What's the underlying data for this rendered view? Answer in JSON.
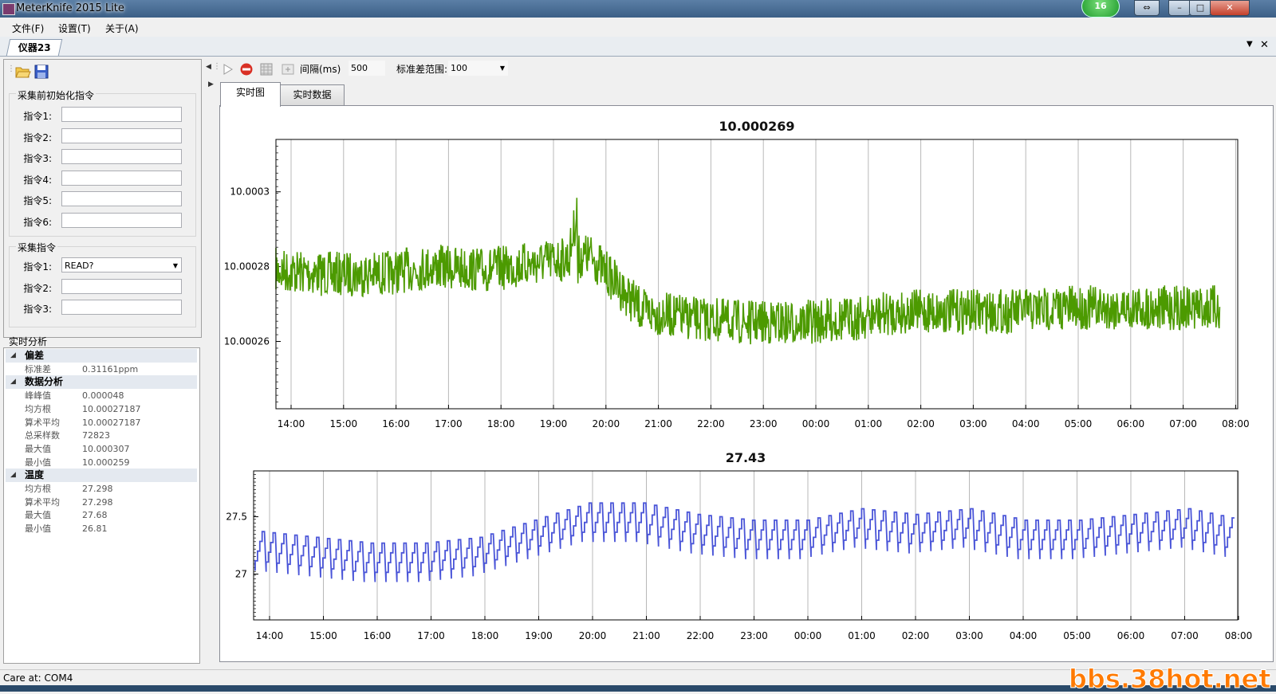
{
  "window": {
    "title": "MeterKnife 2015 Lite",
    "badge": "16"
  },
  "menu": {
    "file": "文件(F)",
    "settings": "设置(T)",
    "about": "关于(A)"
  },
  "doc_tab": "仪器23",
  "init_group": {
    "title": "采集前初始化指令",
    "fields": [
      {
        "label": "指令1:",
        "value": ""
      },
      {
        "label": "指令2:",
        "value": ""
      },
      {
        "label": "指令3:",
        "value": ""
      },
      {
        "label": "指令4:",
        "value": ""
      },
      {
        "label": "指令5:",
        "value": ""
      },
      {
        "label": "指令6:",
        "value": ""
      }
    ]
  },
  "acq_group": {
    "title": "采集指令",
    "fields": [
      {
        "label": "指令1:",
        "value": "READ?"
      },
      {
        "label": "指令2:",
        "value": ""
      },
      {
        "label": "指令3:",
        "value": ""
      }
    ]
  },
  "analysis": {
    "title": "实时分析",
    "rows": [
      {
        "type": "cat",
        "label": "偏差"
      },
      {
        "type": "item",
        "label": "标准差",
        "value": "0.31161ppm"
      },
      {
        "type": "cat",
        "label": "数据分析"
      },
      {
        "type": "item",
        "label": "峰峰值",
        "value": "0.000048"
      },
      {
        "type": "item",
        "label": "均方根",
        "value": "10.00027187"
      },
      {
        "type": "item",
        "label": "算术平均",
        "value": "10.00027187"
      },
      {
        "type": "item",
        "label": "总采样数",
        "value": "72823"
      },
      {
        "type": "item",
        "label": "最大值",
        "value": "10.000307"
      },
      {
        "type": "item",
        "label": "最小值",
        "value": "10.000259"
      },
      {
        "type": "cat",
        "label": "温度"
      },
      {
        "type": "item",
        "label": "均方根",
        "value": "27.298"
      },
      {
        "type": "item",
        "label": "算术平均",
        "value": "27.298"
      },
      {
        "type": "item",
        "label": "最大值",
        "value": "27.68"
      },
      {
        "type": "item",
        "label": "最小值",
        "value": "26.81"
      }
    ]
  },
  "toolbar": {
    "interval_label": "间隔(ms)",
    "interval_value": "500",
    "std_range_label": "标准差范围:",
    "std_range_value": "100"
  },
  "tabs": {
    "chart": "实时图",
    "data": "实时数据"
  },
  "status": {
    "text": "Care at:  COM4"
  },
  "watermark": "bbs.38hot.net",
  "colors": {
    "voltage_series": "#4c9a00",
    "temperature_series": "#4a55d8"
  },
  "chart_data": [
    {
      "type": "line",
      "title": "10.000269",
      "x": [
        "14:00",
        "15:00",
        "16:00",
        "17:00",
        "18:00",
        "19:00",
        "20:00",
        "21:00",
        "22:00",
        "23:00",
        "00:00",
        "01:00",
        "02:00",
        "03:00",
        "04:00",
        "05:00",
        "06:00",
        "07:00",
        "08:00"
      ],
      "yticks": [
        "10.00026",
        "10.00028",
        "10.0003"
      ],
      "ylim": [
        10.000242,
        10.000314
      ],
      "grid": "vertical",
      "series": [
        {
          "values": [
            10.000279,
            10.000278,
            10.000278,
            10.00028,
            10.000279,
            10.000281,
            10.000283,
            10.000268,
            10.000266,
            10.000265,
            10.000265,
            10.000266,
            10.000268,
            10.000268,
            10.000268,
            10.000269,
            10.000269,
            10.000269,
            10.000269
          ]
        }
      ]
    },
    {
      "type": "line",
      "title": "27.43",
      "x": [
        "14:00",
        "15:00",
        "16:00",
        "17:00",
        "18:00",
        "19:00",
        "20:00",
        "21:00",
        "22:00",
        "23:00",
        "00:00",
        "01:00",
        "02:00",
        "03:00",
        "04:00",
        "05:00",
        "06:00",
        "07:00",
        "08:00"
      ],
      "yticks": [
        "27",
        "27.5"
      ],
      "ylim": [
        26.6,
        27.9
      ],
      "grid": "vertical",
      "series": [
        {
          "values": [
            27.2,
            27.15,
            27.1,
            27.1,
            27.15,
            27.3,
            27.45,
            27.45,
            27.35,
            27.3,
            27.3,
            27.4,
            27.35,
            27.4,
            27.3,
            27.3,
            27.35,
            27.4,
            27.3
          ]
        }
      ]
    }
  ]
}
